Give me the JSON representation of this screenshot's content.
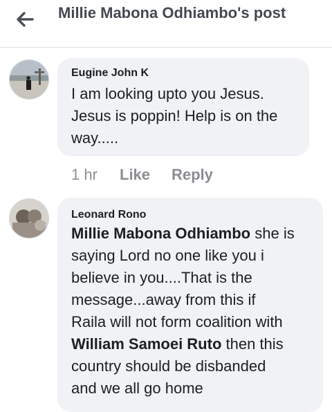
{
  "header": {
    "title": "Millie Mabona Odhiambo's post",
    "back_icon": "arrow-left-icon"
  },
  "comments": [
    {
      "author": "Eugine John K",
      "text_lines": [
        "I am looking upto you Jesus.",
        "Jesus is poppin! Help is on the",
        "way....."
      ],
      "time": "1 hr",
      "like_label": "Like",
      "reply_label": "Reply"
    },
    {
      "author": "Leonard Rono",
      "mention1": "Millie Mabona Odhiambo",
      "line1_rest": " she is",
      "lines_mid": [
        "saying Lord no one like you i",
        "believe in you....That is the",
        "message...away from this if",
        "Raila will not form coalition with"
      ],
      "mention2": "William Samoei Ruto",
      "line6_rest": " then this",
      "lines_end": [
        "country should be disbanded",
        "and we all go home"
      ]
    }
  ]
}
